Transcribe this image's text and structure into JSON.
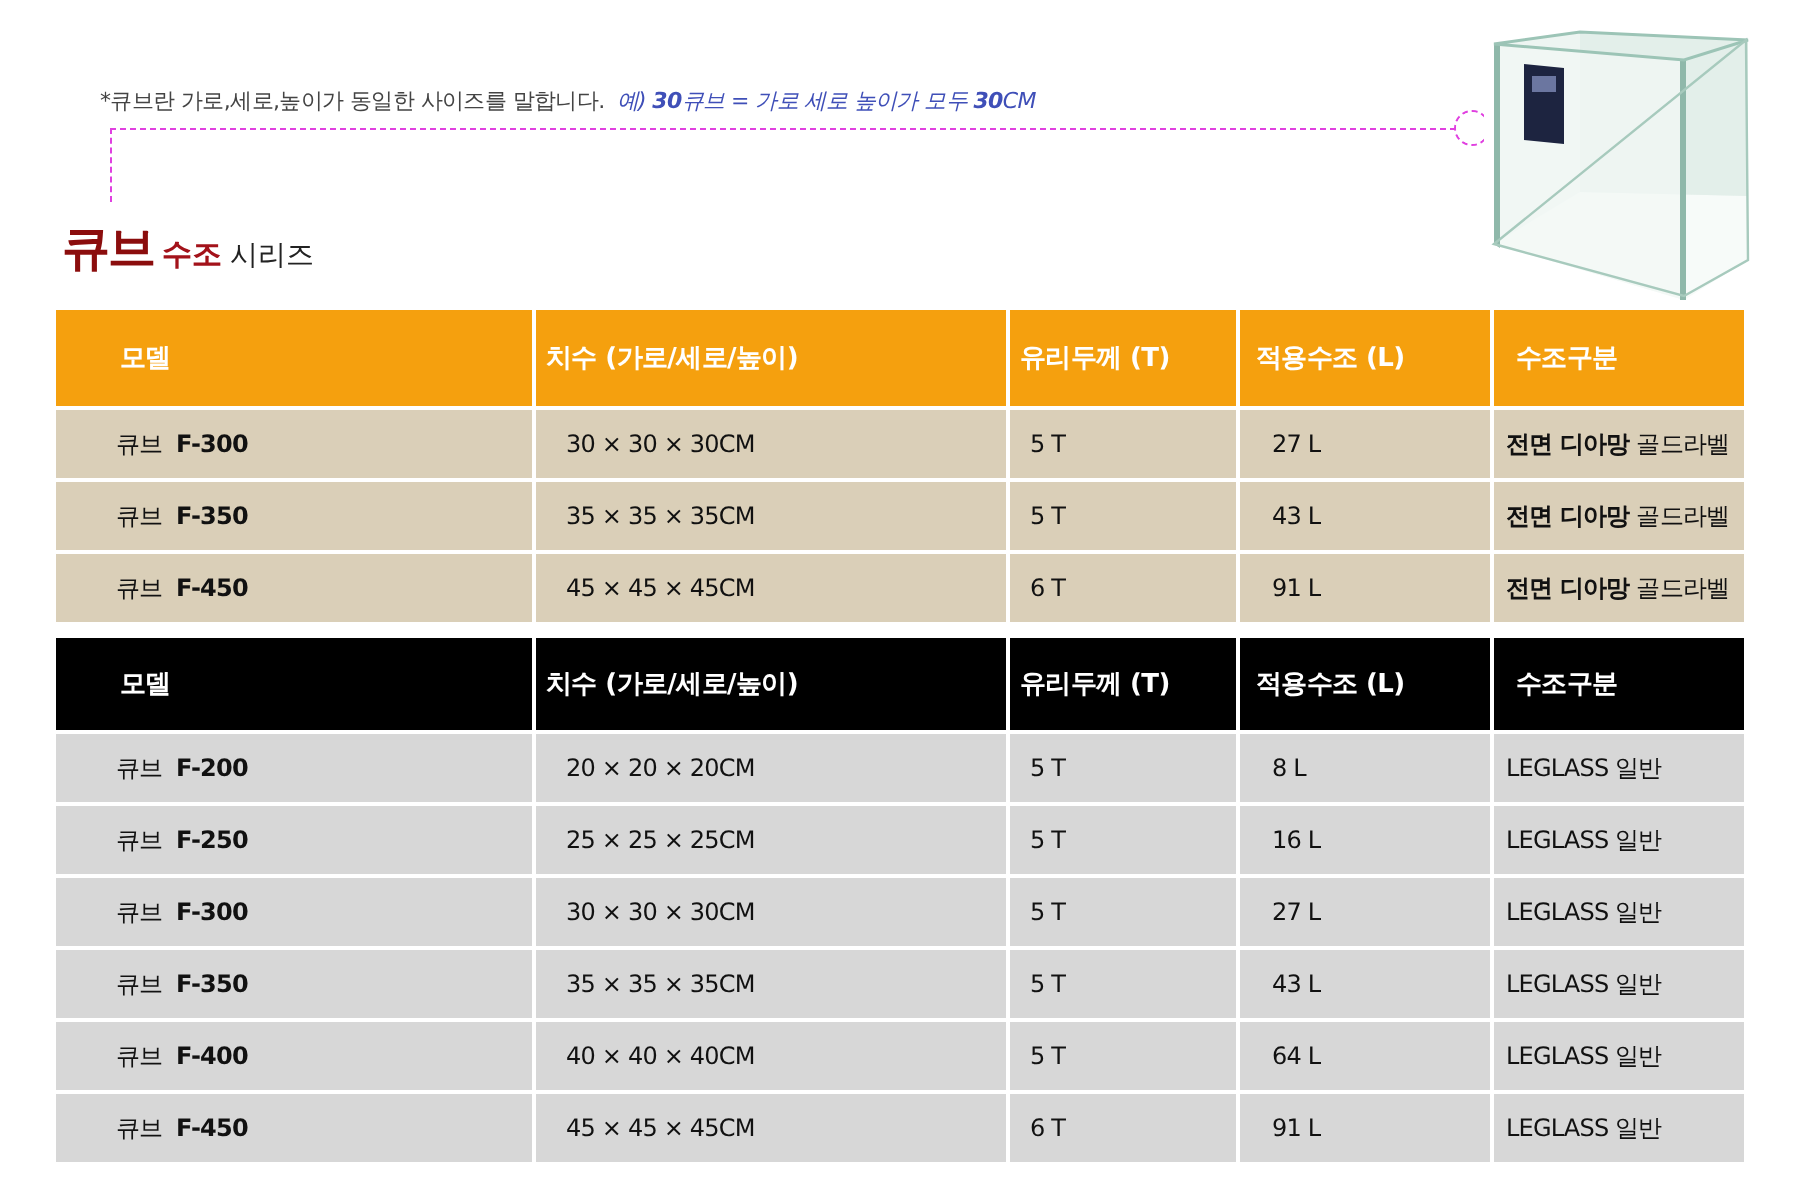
{
  "note": {
    "text": "*큐브란 가로,세로,높이가 동일한 사이즈를 말합니다.",
    "example": "예) **30**큐브 = 가로 세로 높이가 모두 **30**CM"
  },
  "title": {
    "main": "큐브",
    "sub": "수조",
    "suffix": "시리즈"
  },
  "tables": [
    {
      "kind": "orange",
      "columns": [
        "모델",
        "치수 (가로/세로/높이)",
        "유리두께 (T)",
        "적용수조 (L)",
        "수조구분"
      ],
      "rows": [
        [
          "큐브  **F-300**",
          "30 × 30 × 30CM",
          "5 T",
          "27 L",
          "**전면 디아망** 골드라벨"
        ],
        [
          "큐브  **F-350**",
          "35 × 35 × 35CM",
          "5 T",
          "43 L",
          "**전면 디아망** 골드라벨"
        ],
        [
          "큐브  **F-450**",
          "45 × 45 × 45CM",
          "6 T",
          "91 L",
          "**전면 디아망** 골드라벨"
        ]
      ]
    },
    {
      "kind": "black",
      "columns": [
        "모델",
        "치수 (가로/세로/높이)",
        "유리두께 (T)",
        "적용수조 (L)",
        "수조구분"
      ],
      "rows": [
        [
          "큐브  **F-200**",
          "20 × 20 × 20CM",
          "5 T",
          "8 L",
          "LEGLASS 일반"
        ],
        [
          "큐브  **F-250**",
          "25 × 25 × 25CM",
          "5 T",
          "16 L",
          "LEGLASS 일반"
        ],
        [
          "큐브  **F-300**",
          "30 × 30 × 30CM",
          "5 T",
          "27 L",
          "LEGLASS 일반"
        ],
        [
          "큐브  **F-350**",
          "35 × 35 × 35CM",
          "5 T",
          "43 L",
          "LEGLASS 일반"
        ],
        [
          "큐브  **F-400**",
          "40 × 40 × 40CM",
          "5 T",
          "64 L",
          "LEGLASS 일반"
        ],
        [
          "큐브  **F-450**",
          "45 × 45 × 45CM",
          "6 T",
          "91 L",
          "LEGLASS 일반"
        ]
      ]
    }
  ]
}
